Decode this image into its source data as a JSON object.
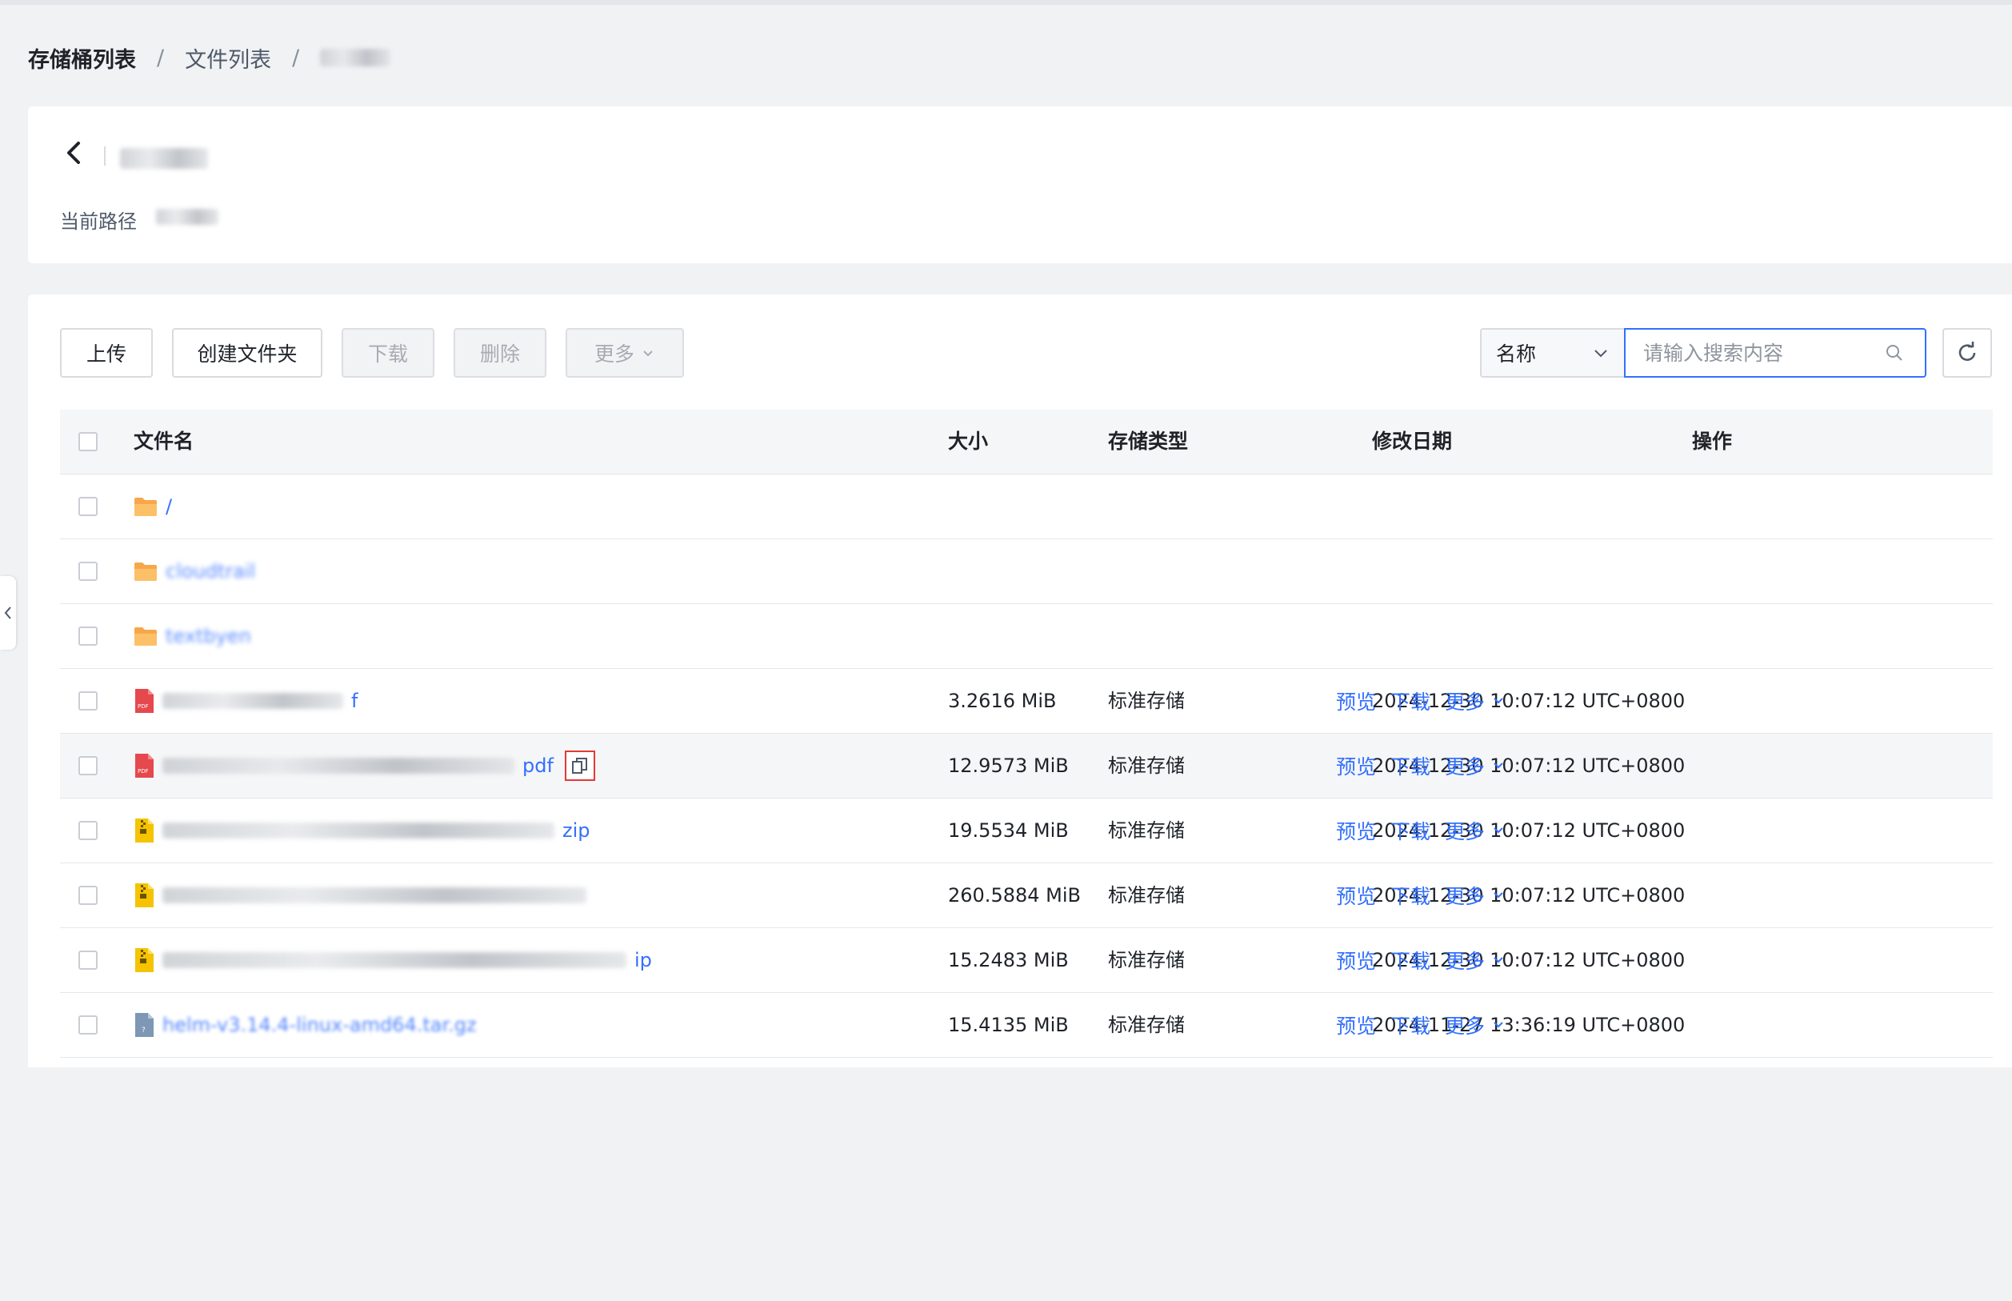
{
  "breadcrumb": {
    "root": "存储桶列表",
    "files": "文件列表",
    "separator": "/"
  },
  "header": {
    "path_label": "当前路径"
  },
  "toolbar": {
    "upload": "上传",
    "create_folder": "创建文件夹",
    "download": "下载",
    "delete": "删除",
    "more": "更多"
  },
  "search": {
    "field_select": "名称",
    "placeholder": "请输入搜索内容"
  },
  "table": {
    "headers": {
      "name": "文件名",
      "size": "大小",
      "storage_type": "存储类型",
      "modified": "修改日期",
      "actions": "操作"
    },
    "rows": [
      {
        "name": "/",
        "type": "folder"
      },
      {
        "name": "cloudtrail",
        "type": "folder"
      },
      {
        "name": "textbyen",
        "type": "folder"
      },
      {
        "name": "f",
        "type": "pdf",
        "size": "3.2616 MiB",
        "storage": "标准存储",
        "date": "2024-12-30 10:07:12 UTC+0800"
      },
      {
        "name": "pdf",
        "type": "pdf",
        "size": "12.9573 MiB",
        "storage": "标准存储",
        "date": "2024-12-30 10:07:12 UTC+0800"
      },
      {
        "name": "zip",
        "type": "zip",
        "size": "19.5534 MiB",
        "storage": "标准存储",
        "date": "2024-12-30 10:07:12 UTC+0800"
      },
      {
        "name": "",
        "type": "zip",
        "size": "260.5884 MiB",
        "storage": "标准存储",
        "date": "2024-12-30 10:07:12 UTC+0800"
      },
      {
        "name": "ip",
        "type": "zip",
        "size": "15.2483 MiB",
        "storage": "标准存储",
        "date": "2024-12-30 10:07:12 UTC+0800"
      },
      {
        "name": "helm-v3.14.4-linux-amd64.tar.gz",
        "type": "unknown",
        "size": "15.4135 MiB",
        "storage": "标准存储",
        "date": "2024-11-27 13:36:19 UTC+0800"
      }
    ],
    "actions": {
      "preview": "预览",
      "download": "下载",
      "more": "更多"
    }
  },
  "icons": [
    "back-icon",
    "chevron-down-icon",
    "search-icon",
    "refresh-icon",
    "folder-icon",
    "pdf-icon",
    "zip-icon",
    "file-icon",
    "copy-icon",
    "chevron-left-icon"
  ],
  "colors": {
    "accent": "#3370ff",
    "folder": "#f7a74a",
    "pdf": "#e5484d",
    "zip": "#f5c300",
    "highlight": "#e53935"
  }
}
